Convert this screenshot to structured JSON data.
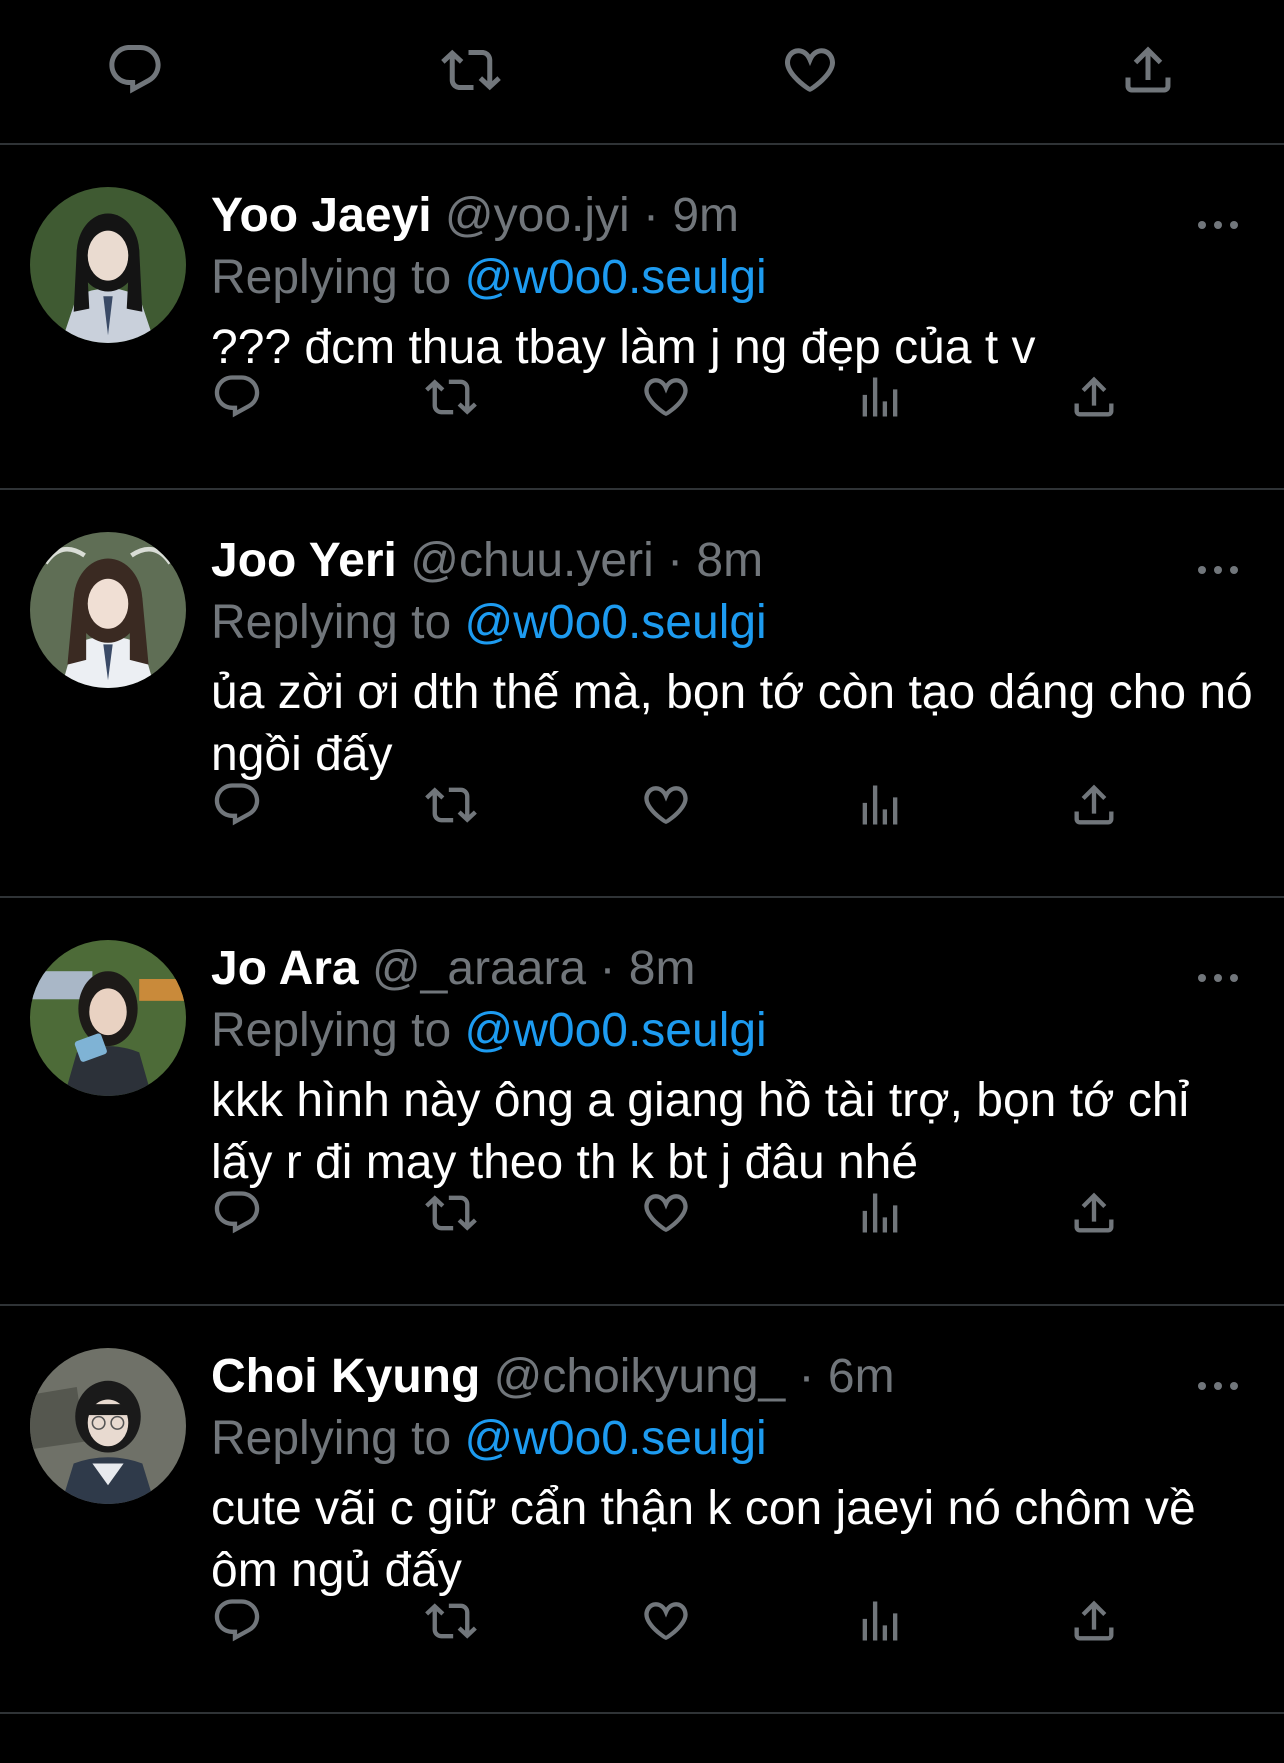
{
  "top_actions": {
    "icons": [
      "reply-icon",
      "retweet-icon",
      "like-icon",
      "share-icon"
    ],
    "color": "#71767b"
  },
  "replies": [
    {
      "name": "Yoo Jaeyi",
      "handle": "@yoo.jyi",
      "separator": "·",
      "time": "9m",
      "replying_label": "Replying to",
      "mention": "@w0o0.seulgi",
      "text": "??? đcm thua tbay làm j ng đẹp của t v",
      "avatar": {
        "bg": "#3f5a32",
        "skin": "#eadbd0",
        "hair": "#141414",
        "uniform": "#c9d0db"
      }
    },
    {
      "name": "Joo Yeri",
      "handle": "@chuu.yeri",
      "separator": "·",
      "time": "8m",
      "replying_label": "Replying to",
      "mention": "@w0o0.seulgi",
      "text": "ủa zời ơi dth thế mà, bọn tớ còn tạo dáng cho nó ngồi đấy",
      "avatar": {
        "bg": "#5f6e55",
        "skin": "#f0dfd4",
        "hair": "#3a2a22",
        "uniform": "#eceff3"
      }
    },
    {
      "name": "Jo Ara",
      "handle": "@_araara",
      "separator": "·",
      "time": "8m",
      "replying_label": "Replying to",
      "mention": "@w0o0.seulgi",
      "text": "kkk hình này ông a giang hồ tài trợ, bọn tớ chỉ lấy r đi may theo th k bt j đâu nhé",
      "avatar": {
        "bg": "#4d6b38",
        "skin": "#e9d2c2",
        "hair": "#1d1a18",
        "uniform": "#2c3139"
      }
    },
    {
      "name": "Choi Kyung",
      "handle": "@choikyung_",
      "separator": "·",
      "time": "6m",
      "replying_label": "Replying to",
      "mention": "@w0o0.seulgi",
      "text": "cute vãi c giữ cẩn thận k con jaeyi nó chôm về ôm ngủ đấy",
      "avatar": {
        "bg": "#6f7168",
        "skin": "#e8dad0",
        "hair": "#1a1a1a",
        "uniform": "#2f3a4a"
      }
    }
  ],
  "reply_actions": {
    "icons": [
      "reply-icon",
      "retweet-icon",
      "like-icon",
      "views-icon",
      "share-icon"
    ]
  },
  "colors": {
    "background": "#000000",
    "divider": "#2f3336",
    "muted": "#71767b",
    "accent": "#1d9bf0",
    "text": "#ffffff"
  }
}
